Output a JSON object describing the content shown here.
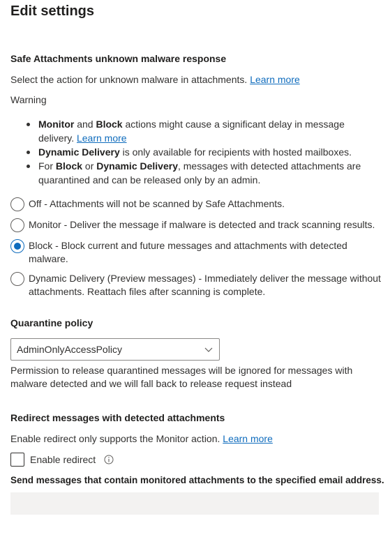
{
  "page": {
    "title": "Edit settings"
  },
  "safe_attachments": {
    "heading": "Safe Attachments unknown malware response",
    "description": "Select the action for unknown malware in attachments.",
    "learn_more": "Learn more",
    "warning_label": "Warning",
    "warnings": {
      "w1_b1": "Monitor",
      "w1_t1": " and ",
      "w1_b2": "Block",
      "w1_t2": " actions might cause a significant delay in message delivery. ",
      "w1_link": "Learn more",
      "w2_b1": "Dynamic Delivery",
      "w2_t1": " is only available for recipients with hosted mailboxes.",
      "w3_t0": "For ",
      "w3_b1": "Block",
      "w3_t1": " or ",
      "w3_b2": "Dynamic Delivery",
      "w3_t2": ", messages with detected attachments are quarantined and can be released only by an admin."
    },
    "options": [
      {
        "label": "Off - Attachments will not be scanned by Safe Attachments.",
        "checked": false
      },
      {
        "label": "Monitor - Deliver the message if malware is detected and track scanning results.",
        "checked": false
      },
      {
        "label": "Block - Block current and future messages and attachments with detected malware.",
        "checked": true
      },
      {
        "label": "Dynamic Delivery (Preview messages) - Immediately deliver the message without attachments. Reattach files after scanning is complete.",
        "checked": false
      }
    ]
  },
  "quarantine": {
    "heading": "Quarantine policy",
    "selected": "AdminOnlyAccessPolicy",
    "note": "Permission to release quarantined messages will be ignored for messages with malware detected and we will fall back to release request instead"
  },
  "redirect": {
    "heading": "Redirect messages with detected attachments",
    "description": "Enable redirect only supports the Monitor action.",
    "learn_more": "Learn more",
    "checkbox_label": "Enable redirect",
    "checked": false,
    "email_label": "Send messages that contain monitored attachments to the specified email address.",
    "email_value": ""
  },
  "colors": {
    "accent": "#0f6cbd",
    "text": "#323130",
    "input_bg": "#f3f2f1"
  }
}
